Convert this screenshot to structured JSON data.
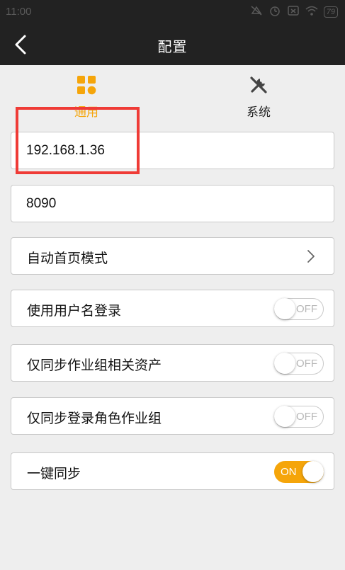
{
  "status_bar": {
    "time": "11:00",
    "icons": [
      "mute-icon",
      "alarm-icon",
      "sim-icon",
      "wifi-icon"
    ],
    "battery": "79"
  },
  "header": {
    "title": "配置"
  },
  "tabs": [
    {
      "label": "通用",
      "icon": "grid-icon",
      "active": true,
      "color": "#f5a50a"
    },
    {
      "label": "系统",
      "icon": "tools-icon",
      "active": false
    }
  ],
  "settings": {
    "ip_address": "192.168.1.36",
    "port": "8090",
    "home_mode_label": "自动首页模式",
    "toggles": [
      {
        "label": "使用用户名登录",
        "state": "OFF"
      },
      {
        "label": "仅同步作业组相关资产",
        "state": "OFF"
      },
      {
        "label": "仅同步登录角色作业组",
        "state": "OFF"
      },
      {
        "label": "一键同步",
        "state": "ON"
      }
    ]
  },
  "colors": {
    "accent": "#f5a50a",
    "highlight": "#ef3b36",
    "bar": "#222222"
  }
}
